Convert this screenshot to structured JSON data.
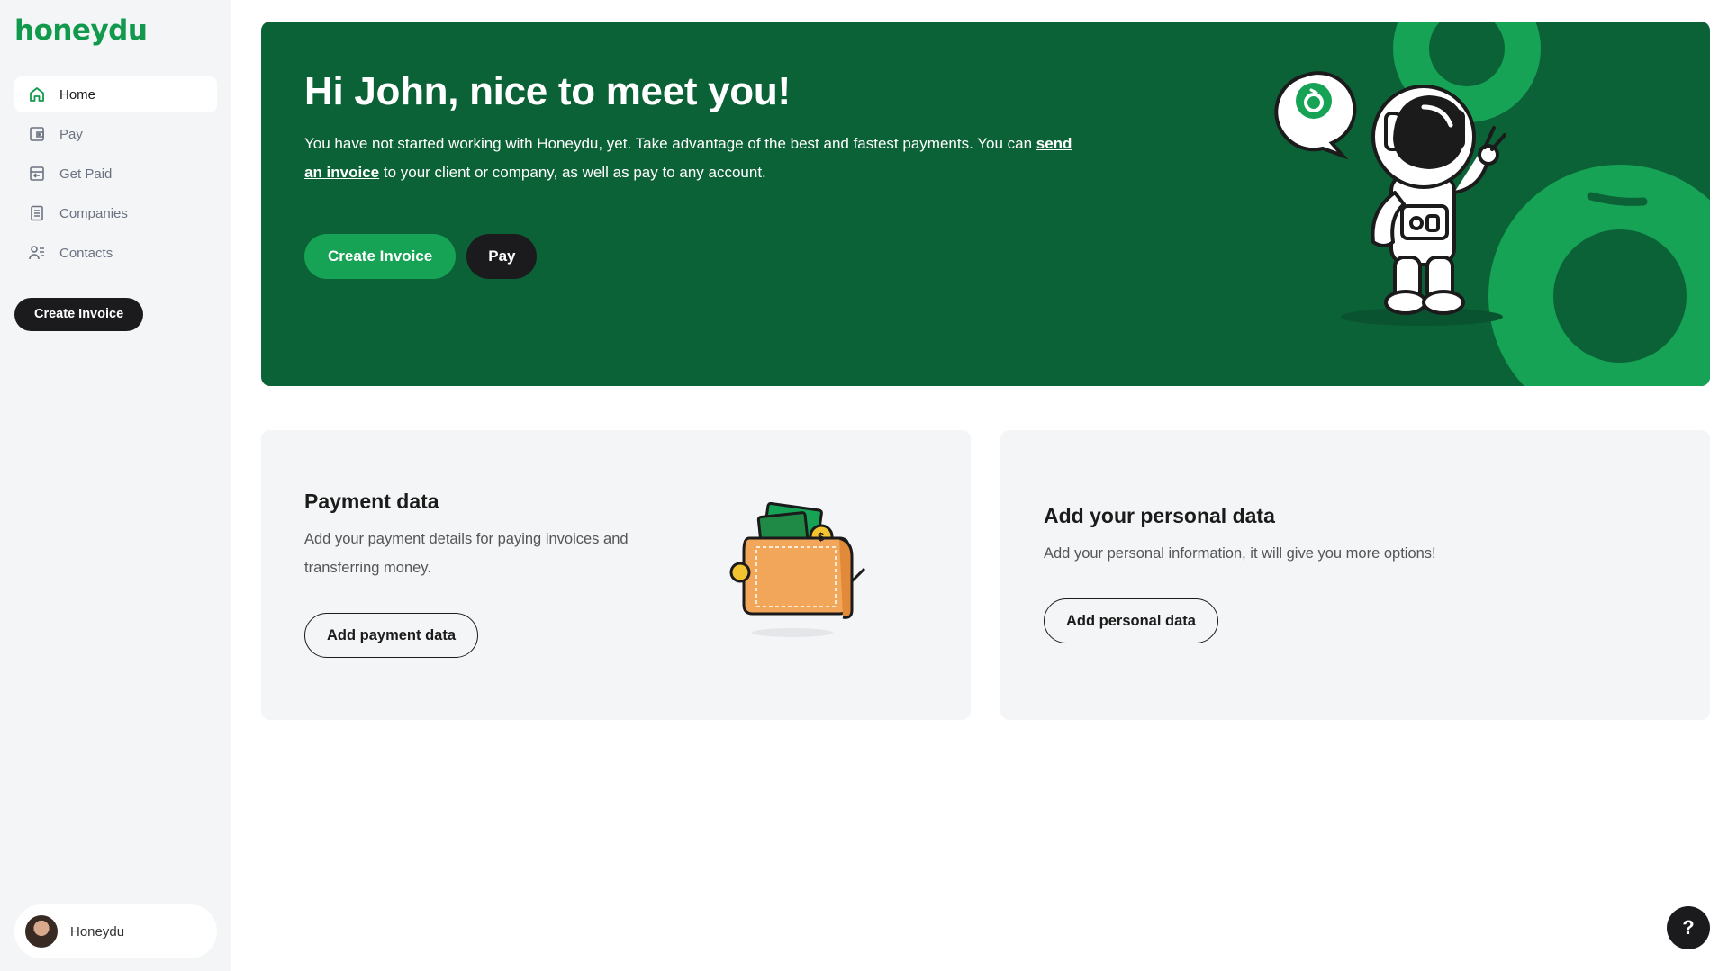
{
  "brand": {
    "logo_text": "honeydu",
    "accent": "#16a355",
    "dark_green": "#0c6237"
  },
  "sidebar": {
    "items": [
      {
        "label": "Home",
        "icon": "home-icon",
        "active": true
      },
      {
        "label": "Pay",
        "icon": "wallet-icon",
        "active": false
      },
      {
        "label": "Get Paid",
        "icon": "receive-icon",
        "active": false
      },
      {
        "label": "Companies",
        "icon": "document-icon",
        "active": false
      },
      {
        "label": "Contacts",
        "icon": "contacts-icon",
        "active": false
      }
    ],
    "cta_label": "Create Invoice",
    "profile_name": "Honeydu"
  },
  "hero": {
    "title": "Hi John, nice to meet you!",
    "text_before": "You have not started working with Honeydu, yet. Take advantage of the best and fastest payments. You can ",
    "link_text": "send an invoice",
    "text_after": " to your client or company, as well as pay to any account.",
    "primary_button": "Create Invoice",
    "secondary_button": "Pay"
  },
  "cards": {
    "payment": {
      "title": "Payment data",
      "text": "Add your payment details for paying invoices and transferring money.",
      "button": "Add payment data"
    },
    "personal": {
      "title": "Add your personal data",
      "text": "Add your personal information, it will give you more options!",
      "button": "Add personal data"
    }
  },
  "help_label": "?"
}
